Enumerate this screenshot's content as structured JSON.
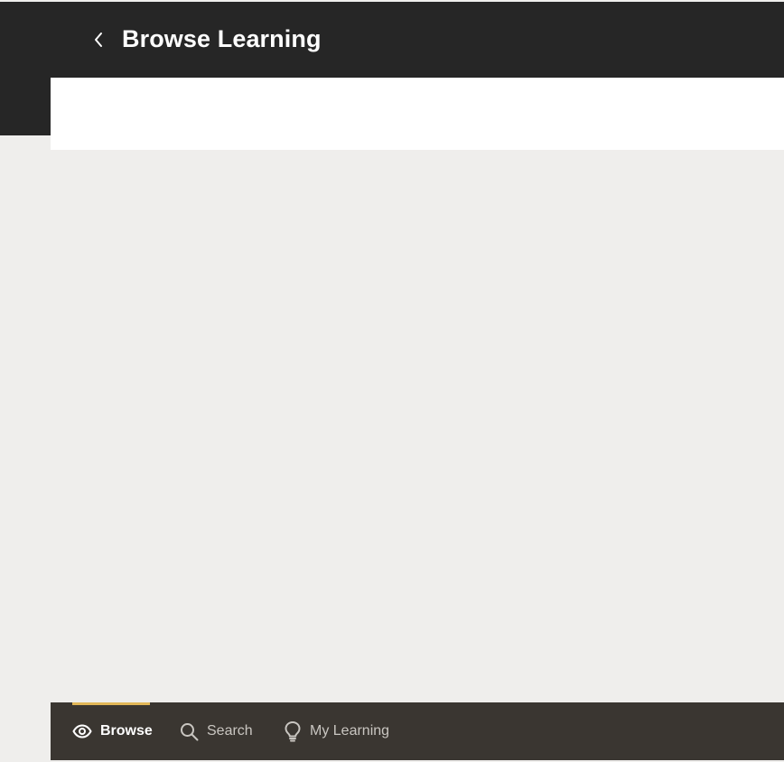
{
  "header": {
    "title": "Browse Learning",
    "back_icon": "chevron-left-icon"
  },
  "bottom_nav": {
    "items": [
      {
        "label": "Browse",
        "icon": "eye-icon",
        "active": true
      },
      {
        "label": "Search",
        "icon": "search-icon",
        "active": false
      },
      {
        "label": "My Learning",
        "icon": "lightbulb-icon",
        "active": false
      }
    ]
  },
  "colors": {
    "header_bg": "#262626",
    "page_bg": "#efeeec",
    "panel_bg": "#ffffff",
    "nav_bg": "#3a3631",
    "nav_active_indicator": "#e2b758",
    "nav_active_text": "#ffffff",
    "nav_inactive_text": "#c9c6c1"
  }
}
